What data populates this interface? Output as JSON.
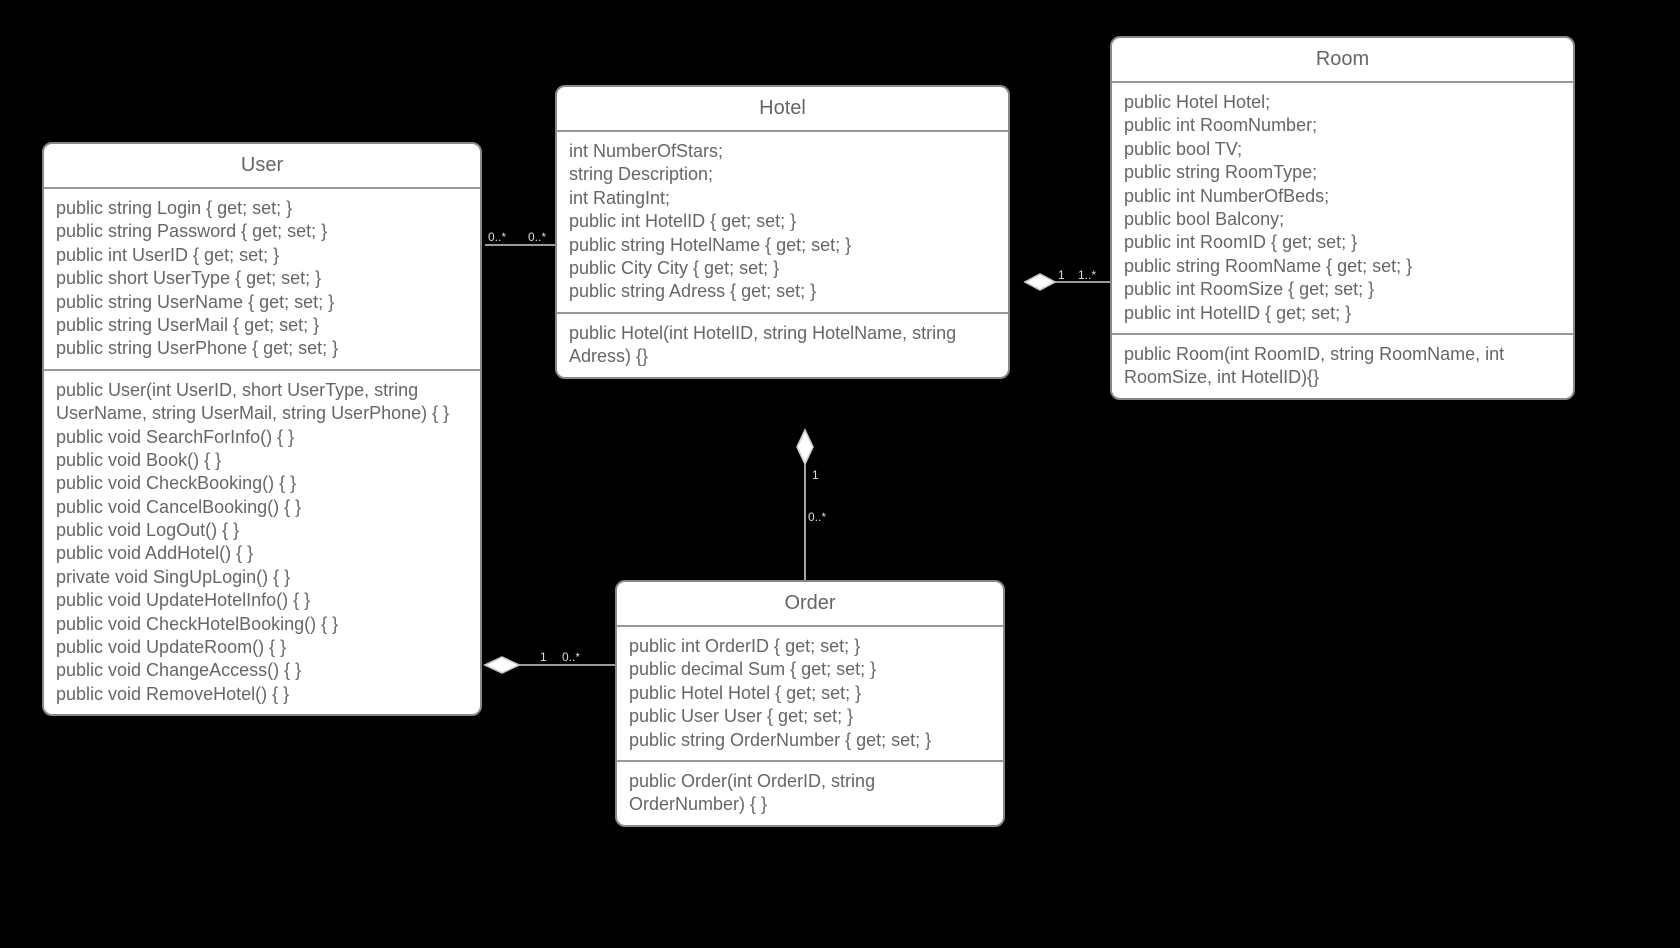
{
  "classes": {
    "user": {
      "name": "User",
      "attrs": [
        "public string Login { get; set; }",
        "public string Password { get; set; }",
        "public int UserID { get; set; }",
        "public short UserType { get; set; }",
        "public string UserName { get; set; }",
        "public string UserMail { get; set; }",
        "public string UserPhone { get; set; }"
      ],
      "ops": [
        "public User(int UserID, short UserType, string UserName, string UserMail, string UserPhone) { }",
        "public void SearchForInfo() { }",
        "public void Book() { }",
        "public void CheckBooking() { }",
        "public void CancelBooking() { }",
        "public void LogOut() { }",
        "public void AddHotel() { }",
        "private void SingUpLogin() { }",
        "public void UpdateHotelInfo() { }",
        "public void CheckHotelBooking() { }",
        "public void UpdateRoom() { }",
        "public void ChangeAccess() { }",
        "public void RemoveHotel() { }"
      ]
    },
    "hotel": {
      "name": "Hotel",
      "attrs": [
        "int NumberOfStars;",
        "string Description;",
        "int RatingInt;",
        "public int HotelID { get; set; }",
        "public string HotelName { get; set; }",
        "public City City { get; set; }",
        "public string Adress { get; set; }"
      ],
      "ops": [
        "public Hotel(int HotelID, string HotelName, string Adress) {}"
      ]
    },
    "room": {
      "name": "Room",
      "attrs": [
        "public Hotel Hotel;",
        "public int RoomNumber;",
        "public bool TV;",
        "public string RoomType;",
        "public int NumberOfBeds;",
        "public bool Balcony;",
        "public int RoomID { get; set; }",
        "public string RoomName { get; set; }",
        "public int RoomSize { get; set; }",
        "public int HotelID { get; set; }"
      ],
      "ops": [
        "public Room(int RoomID, string RoomName, int RoomSize, int HotelID){}"
      ]
    },
    "order": {
      "name": "Order",
      "attrs": [
        "public int OrderID { get; set; }",
        "public decimal Sum { get; set; }",
        "public Hotel Hotel { get; set; }",
        "public User User { get; set; }",
        "public string OrderNumber { get; set; }"
      ],
      "ops": [
        "public Order(int OrderID, string OrderNumber) { }"
      ]
    }
  },
  "mult": {
    "user_hotel_left": "0..*",
    "user_hotel_right": "0..*",
    "hotel_room_left": "1",
    "hotel_room_right": "1..*",
    "hotel_order_top": "1",
    "hotel_order_bottom": "0..*",
    "user_order_left": "1",
    "user_order_right": "0..*"
  }
}
